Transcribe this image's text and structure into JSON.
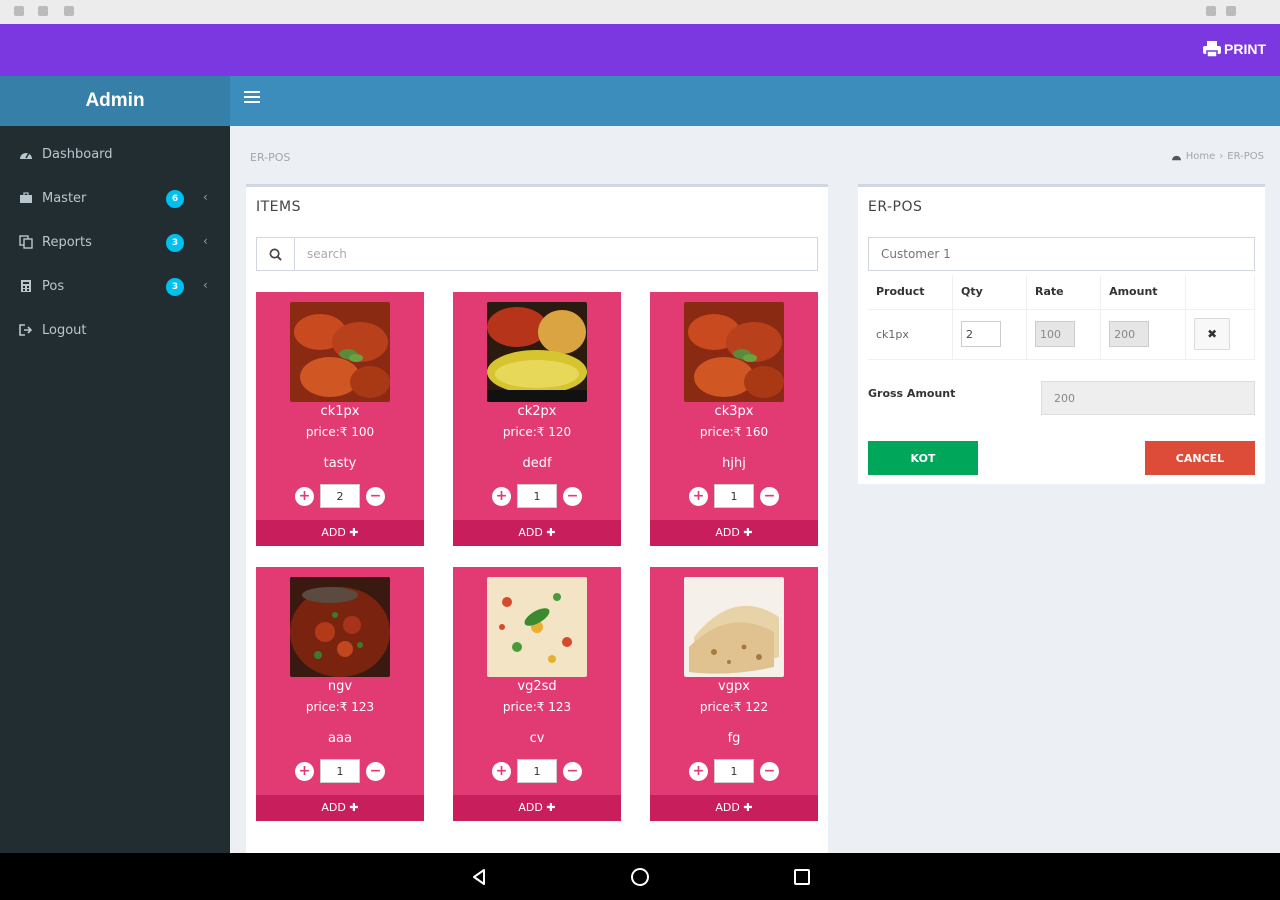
{
  "topbar": {
    "print_label": "PRINT",
    "bg": "#7b38e0"
  },
  "sidebar": {
    "brand": "Admin",
    "items": [
      {
        "label": "Dashboard",
        "icon": "dashboard-icon",
        "badge": ""
      },
      {
        "label": "Master",
        "icon": "briefcase-icon",
        "badge": "6"
      },
      {
        "label": "Reports",
        "icon": "copy-icon",
        "badge": "3"
      },
      {
        "label": "Pos",
        "icon": "calculator-icon",
        "badge": "3"
      },
      {
        "label": "Logout",
        "icon": "logout-icon",
        "badge": ""
      }
    ]
  },
  "page": {
    "title": "ER-POS",
    "breadcrumb": [
      "Home",
      "ER-POS"
    ]
  },
  "items_panel": {
    "title": "ITEMS",
    "search_placeholder": "search",
    "cards": [
      {
        "name": "ck1px",
        "price": "price:₹ 100",
        "desc": "tasty",
        "qty": "2",
        "add": "ADD",
        "img": "chicken"
      },
      {
        "name": "ck2px",
        "price": "price:₹ 120",
        "desc": "dedf",
        "qty": "1",
        "add": "ADD",
        "img": "biryani"
      },
      {
        "name": "ck3px",
        "price": "price:₹ 160",
        "desc": "hjhj",
        "qty": "1",
        "add": "ADD",
        "img": "chicken"
      },
      {
        "name": "ngv",
        "price": "price:₹ 123",
        "desc": "aaa",
        "qty": "1",
        "add": "ADD",
        "img": "curry"
      },
      {
        "name": "vg2sd",
        "price": "price:₹ 123",
        "desc": "cv",
        "qty": "1",
        "add": "ADD",
        "img": "rice"
      },
      {
        "name": "vgpx",
        "price": "price:₹ 122",
        "desc": "fg",
        "qty": "1",
        "add": "ADD",
        "img": "roti"
      }
    ]
  },
  "pos_panel": {
    "title": "ER-POS",
    "customer_placeholder": "Customer 1",
    "headers": {
      "product": "Product",
      "qty": "Qty",
      "rate": "Rate",
      "amount": "Amount"
    },
    "row": {
      "product": "ck1px",
      "qty": "2",
      "rate": "100",
      "amount": "200"
    },
    "gross_label": "Gross Amount",
    "gross_value": "200",
    "kot_label": "KOT",
    "cancel_label": "CANCEL"
  }
}
